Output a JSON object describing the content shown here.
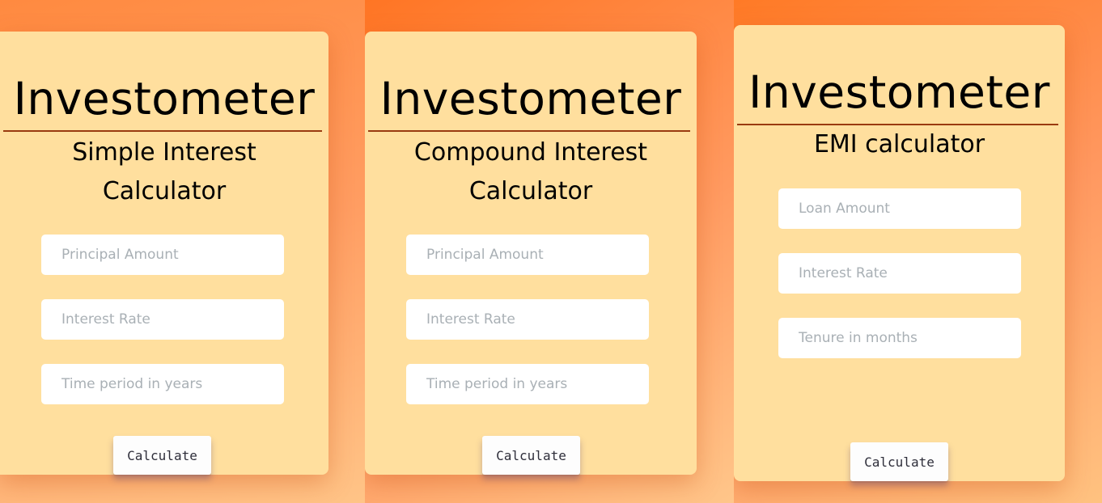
{
  "calculators": [
    {
      "brand": "Investometer",
      "subtitle_line1": "Simple Interest",
      "subtitle_line2": "Calculator",
      "fields": [
        {
          "placeholder": "Principal Amount",
          "value": ""
        },
        {
          "placeholder": "Interest Rate",
          "value": ""
        },
        {
          "placeholder": "Time period in years",
          "value": ""
        }
      ],
      "button_label": "Calculate"
    },
    {
      "brand": "Investometer",
      "subtitle_line1": "Compound Interest",
      "subtitle_line2": "Calculator",
      "fields": [
        {
          "placeholder": "Principal Amount",
          "value": ""
        },
        {
          "placeholder": "Interest Rate",
          "value": ""
        },
        {
          "placeholder": "Time period in years",
          "value": ""
        }
      ],
      "button_label": "Calculate"
    },
    {
      "brand": "Investometer",
      "subtitle_line1": "EMI calculator",
      "fields": [
        {
          "placeholder": "Loan Amount",
          "value": ""
        },
        {
          "placeholder": "Interest Rate",
          "value": ""
        },
        {
          "placeholder": "Tenure in months",
          "value": ""
        }
      ],
      "button_label": "Calculate"
    }
  ],
  "colors": {
    "background_gradient_start": "#ff7a2a",
    "background_gradient_end": "#ffc48a",
    "card": "#ffdf9e",
    "divider": "#9a3a10",
    "placeholder": "#a9b0b5"
  }
}
